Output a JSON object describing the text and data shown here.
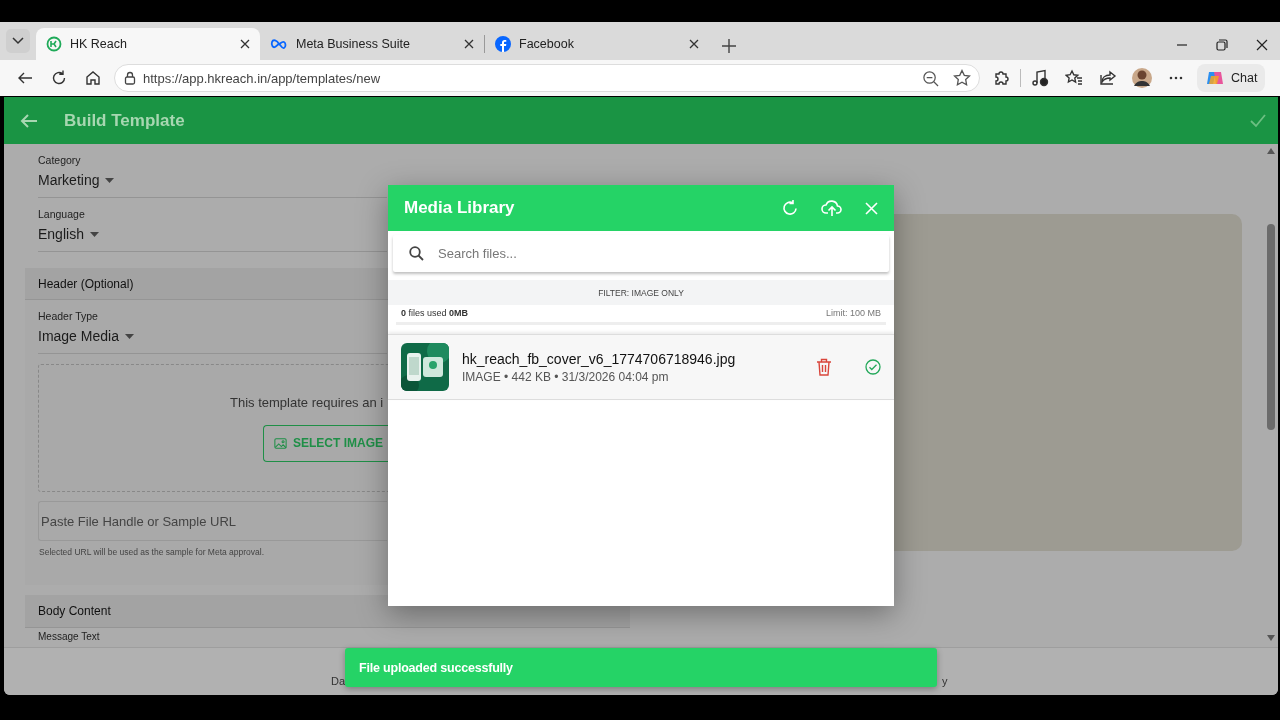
{
  "browser": {
    "tabs": [
      {
        "title": "HK Reach",
        "selected": true
      },
      {
        "title": "Meta Business Suite",
        "selected": false
      },
      {
        "title": "Facebook",
        "selected": false
      }
    ],
    "url": "https://app.hkreach.in/app/templates/new",
    "chat_label": "Chat"
  },
  "app_bar": {
    "title": "Build Template"
  },
  "form": {
    "fields": [
      {
        "label": "Category",
        "value": "Marketing"
      },
      {
        "label": "Language",
        "value": "English"
      }
    ],
    "header_section": "Header (Optional)",
    "header_type": {
      "label": "Header Type",
      "value": "Image Media"
    },
    "media_prompt": "This template requires an i",
    "select_button": "SELECT IMAGE",
    "url_field": {
      "placeholder": "Paste File Handle or Sample URL"
    },
    "url_help": "Selected URL will be used as the sample for Meta approval.",
    "body_section": "Body Content",
    "message_label": "Message Text"
  },
  "footer": {
    "left": "Da",
    "right": "y"
  },
  "media_library": {
    "title": "Media Library",
    "search": {
      "placeholder": "Search files..."
    },
    "filter": "FILTER: IMAGE ONLY",
    "usage": "**0** files used **0MB**",
    "limit": "Limit: 100 MB",
    "files": [
      {
        "name": "hk_reach_fb_cover_v6_1774706718946.jpg",
        "meta": "IMAGE • 442 KB • 31/3/2026 04:04 pm",
        "selected": true
      }
    ]
  },
  "toast": {
    "message": "File uploaded successfully"
  }
}
